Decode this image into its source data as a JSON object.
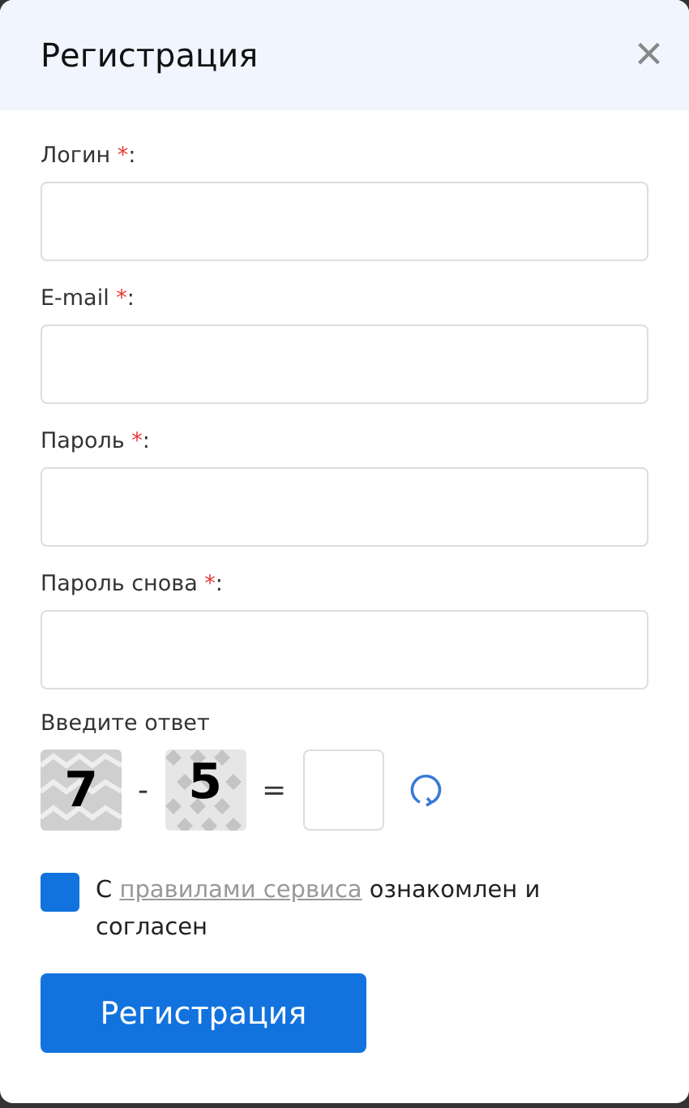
{
  "dialog": {
    "title": "Регистрация",
    "close": "×"
  },
  "fields": [
    {
      "label": "Логин",
      "required_mark": "*",
      "suffix": ":"
    },
    {
      "label": "E-mail",
      "required_mark": "*",
      "suffix": ":"
    },
    {
      "label": "Пароль",
      "required_mark": "*",
      "suffix": ":"
    },
    {
      "label": "Пароль снова",
      "required_mark": "*",
      "suffix": ":"
    }
  ],
  "captcha": {
    "label": "Введите ответ",
    "first": "7",
    "operator": "-",
    "second": "5",
    "equals": "="
  },
  "agreement": {
    "checked": true,
    "before": "С",
    "link": "правилами сервиса",
    "after": "ознакомлен и согласен"
  },
  "submit": "Регистрация"
}
